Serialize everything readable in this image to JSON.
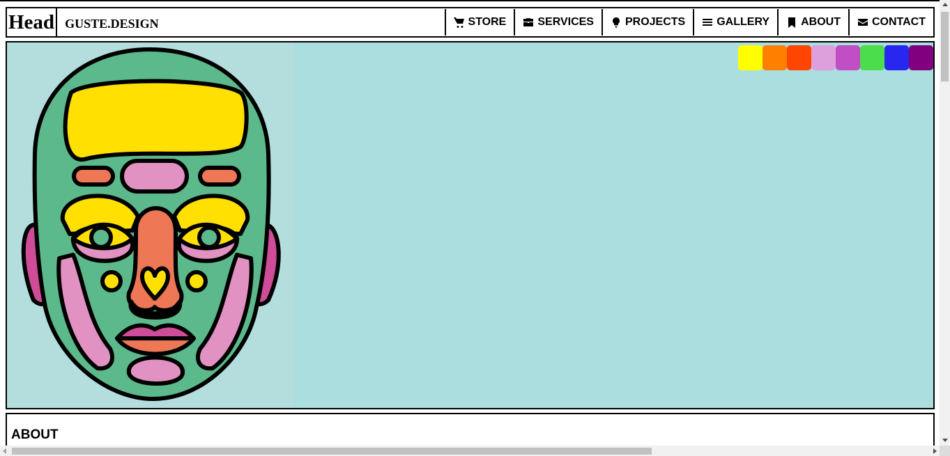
{
  "header": {
    "brand": "Head",
    "sub_brand": "GUSTE.DESIGN",
    "nav": [
      {
        "label": "STORE",
        "icon": "cart-icon"
      },
      {
        "label": "SERVICES",
        "icon": "briefcase-icon"
      },
      {
        "label": "PROJECTS",
        "icon": "lightbulb-icon"
      },
      {
        "label": "GALLERY",
        "icon": "bars-icon"
      },
      {
        "label": "ABOUT",
        "icon": "bookmark-icon"
      },
      {
        "label": "CONTACT",
        "icon": "envelope-icon"
      }
    ]
  },
  "hero": {
    "background": "#aadedf",
    "image": "illustrated-face",
    "swatches": [
      "#ffff00",
      "#ff7f00",
      "#ff4500",
      "#dda0dd",
      "#c04ec4",
      "#4cdd4c",
      "#2727f0",
      "#800080"
    ]
  },
  "about": {
    "heading": "ABOUT"
  }
}
